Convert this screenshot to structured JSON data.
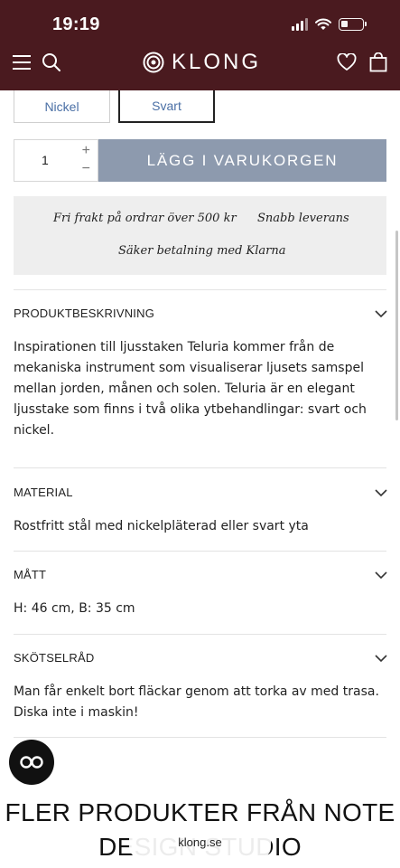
{
  "status_bar": {
    "time": "19:19"
  },
  "header": {
    "brand": "KLONG",
    "brand_color": "#4a1a1f",
    "icons": [
      "menu-icon",
      "search-icon",
      "heart-icon",
      "bag-icon"
    ]
  },
  "variants": [
    {
      "label": "Nickel",
      "selected": false
    },
    {
      "label": "Svart",
      "selected": true
    }
  ],
  "purchase": {
    "quantity": "1",
    "plus": "+",
    "minus": "−",
    "add_to_cart": "LÄGG I VARUKORGEN",
    "button_color": "#8d9aae"
  },
  "info": {
    "free_shipping": "Fri frakt på ordrar över 500 kr",
    "fast_delivery": "Snabb leverans",
    "secure_payment": "Säker betalning med Klarna"
  },
  "accordions": [
    {
      "title": "PRODUKTBESKRIVNING",
      "body": "Inspirationen till ljusstaken Teluria kommer från de mekaniska instrument som visualiserar ljusets samspel mellan jorden, månen och solen. Teluria är en elegant ljusstake som finns i två olika ytbehandlingar: svart och nickel."
    },
    {
      "title": "MATERIAL",
      "body": "Rostfritt stål med nickelpläterad eller svart yta"
    },
    {
      "title": "MÅTT",
      "body": "H: 46 cm, B: 35 cm"
    },
    {
      "title": "SKÖTSELRÅD",
      "body": "Man får enkelt bort fläckar genom att torka av med trasa. Diska inte i maskin!"
    }
  ],
  "more": {
    "line1": "FLER PRODUKTER FRÅN NOTE",
    "line2": "DESIGN STUDIO"
  },
  "browser": {
    "url": "klong.se"
  },
  "chat": {
    "icon": "chat-icon"
  }
}
